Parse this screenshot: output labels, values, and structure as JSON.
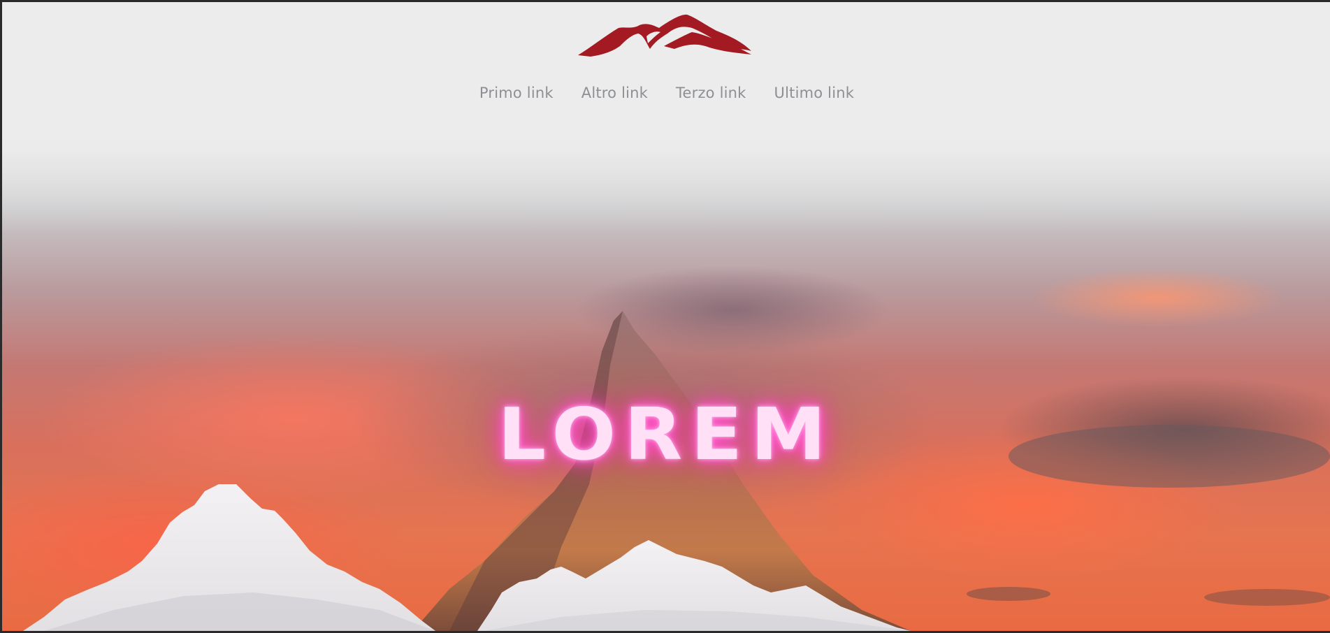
{
  "header": {
    "logo_icon": "mountain-logo-icon",
    "brand_color": "#a31a22"
  },
  "nav": {
    "links": [
      {
        "label": "Primo link"
      },
      {
        "label": "Altro link"
      },
      {
        "label": "Terzo link"
      },
      {
        "label": "Ultimo link"
      }
    ]
  },
  "hero": {
    "title": "LOREM",
    "neon_color": "#ff48c6"
  }
}
